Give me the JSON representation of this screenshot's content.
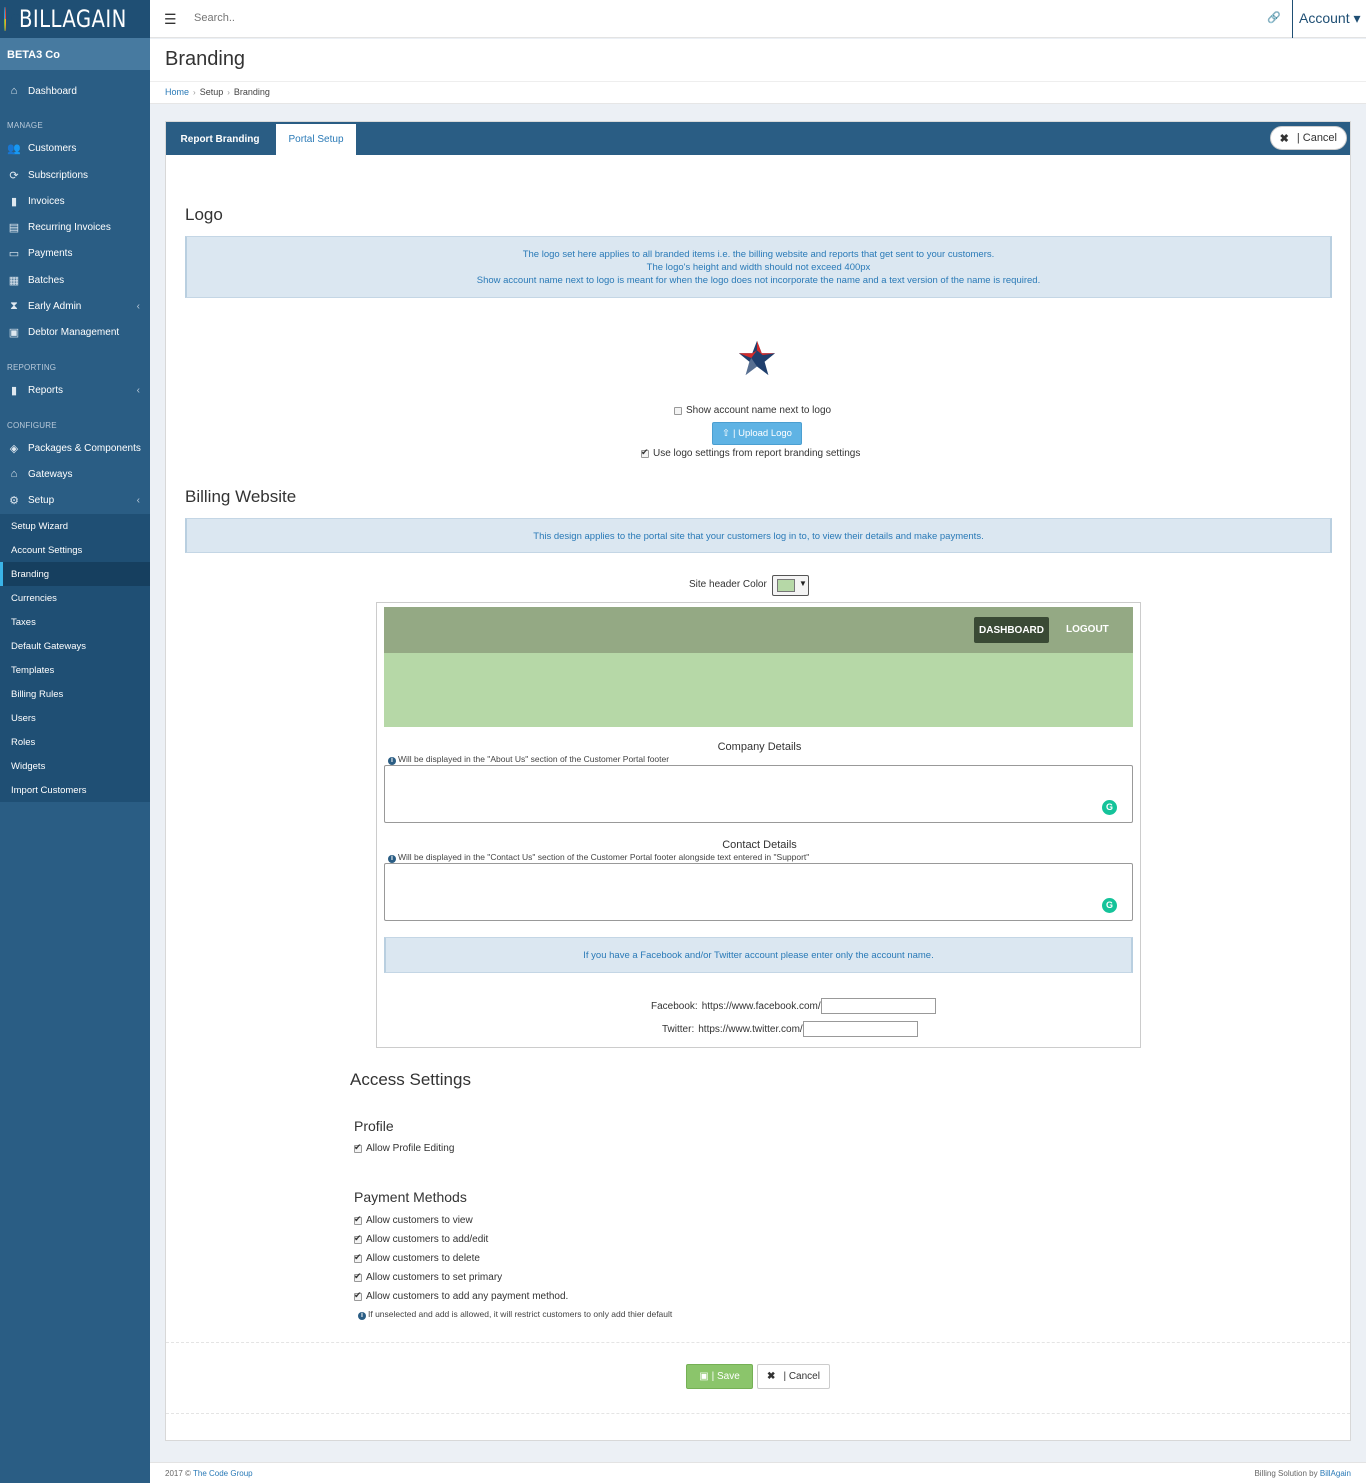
{
  "brand": {
    "name": "BILLAGAIN"
  },
  "company": "BETA3 Co",
  "topbar": {
    "search_placeholder": "Search..",
    "account_label": "Account ▾"
  },
  "sidebar": {
    "dashboard": "Dashboard",
    "manage_heading": "MANAGE",
    "manage": [
      "Customers",
      "Subscriptions",
      "Invoices",
      "Recurring Invoices",
      "Payments",
      "Batches",
      "Early Admin",
      "Debtor Management"
    ],
    "reporting_heading": "REPORTING",
    "reports": "Reports",
    "configure_heading": "CONFIGURE",
    "configure": [
      "Packages & Components",
      "Gateways",
      "Setup"
    ],
    "setup_submenu": [
      "Setup Wizard",
      "Account Settings",
      "Branding",
      "Currencies",
      "Taxes",
      "Default Gateways",
      "Templates",
      "Billing Rules",
      "Users",
      "Roles",
      "Widgets",
      "Import Customers"
    ],
    "active_submenu": "Branding"
  },
  "page": {
    "title": "Branding",
    "breadcrumb": [
      "Home",
      "Setup",
      "Branding"
    ]
  },
  "tabs": {
    "report_branding": "Report Branding",
    "portal_setup": "Portal Setup",
    "cancel": "| Cancel"
  },
  "logo_section": {
    "title": "Logo",
    "info_lines": [
      "The logo set here applies to all branded items i.e. the billing website and reports that get sent to your customers.",
      "The logo's height and width should not exceed 400px",
      "Show account name next to logo is meant for when the logo does not incorporate the name and a text version of the name is required."
    ],
    "show_account_name": {
      "label": "Show account name next to logo",
      "checked": false
    },
    "upload_label": "| Upload Logo",
    "use_report_settings": {
      "label": "Use logo settings from report branding settings",
      "checked": true
    }
  },
  "billing_website": {
    "title": "Billing Website",
    "info": "This design applies to the portal site that your customers log in to, to view their details and make payments.",
    "header_color_label": "Site header Color",
    "header_color": "#b6d8a7",
    "preview": {
      "dashboard_label": "DASHBOARD",
      "logout_label": "LOGOUT",
      "nav_color": "#94a984",
      "company_details_label": "Company Details",
      "company_details_hint": "Will be displayed in the \"About Us\" section of the Customer Portal footer",
      "company_details_value": "",
      "contact_details_label": "Contact Details",
      "contact_details_hint": "Will be displayed in the \"Contact Us\" section of the Customer Portal footer alongside text entered in \"Support\"",
      "contact_details_value": "",
      "social_info": "If you have a Facebook and/or Twitter account please enter only the account name.",
      "facebook_label": "Facebook:",
      "facebook_prefix": "https://www.facebook.com/",
      "facebook_value": "",
      "twitter_label": "Twitter:",
      "twitter_prefix": "https://www.twitter.com/",
      "twitter_value": ""
    }
  },
  "access_settings": {
    "title": "Access Settings",
    "profile_title": "Profile",
    "allow_profile_editing": {
      "label": "Allow Profile Editing",
      "checked": true
    },
    "payment_methods_title": "Payment Methods",
    "payment_methods": [
      {
        "label": "Allow customers to view",
        "checked": true
      },
      {
        "label": "Allow customers to add/edit",
        "checked": true
      },
      {
        "label": "Allow customers to delete",
        "checked": true
      },
      {
        "label": "Allow customers to set primary",
        "checked": true
      },
      {
        "label": "Allow customers to add any payment method.",
        "checked": true
      }
    ],
    "payment_hint": "If unselected and add is allowed, it will restrict customers to only add thier default"
  },
  "actions": {
    "save": "| Save",
    "cancel": "| Cancel"
  },
  "footer": {
    "left_prefix": "2017 ©",
    "left_link": "The Code Group",
    "right_prefix": "Billing Solution by",
    "right_link": "BillAgain"
  },
  "colors": {
    "sidebar": "#2a5d84",
    "accent": "#2a7ab7",
    "save": "#8bc56b"
  }
}
